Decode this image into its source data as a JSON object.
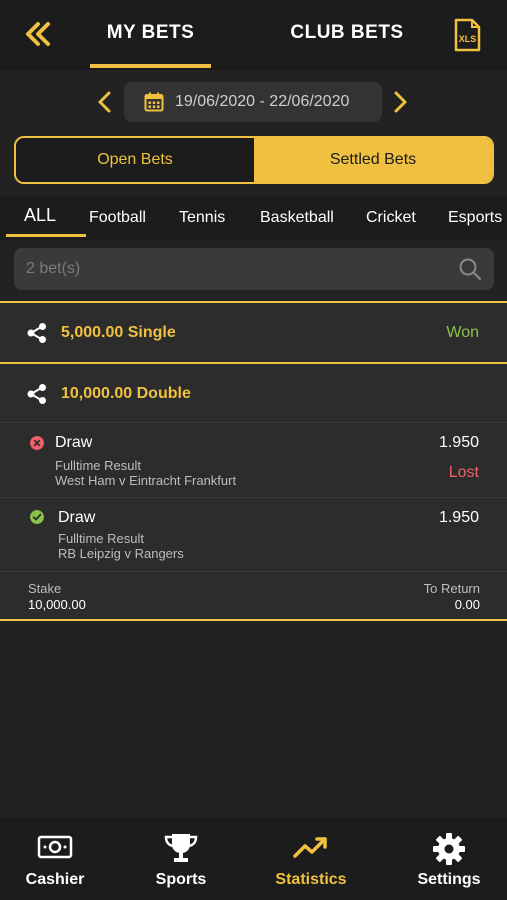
{
  "header": {
    "tabs": [
      {
        "label": "MY BETS",
        "active": true
      },
      {
        "label": "CLUB BETS",
        "active": false
      }
    ],
    "back_icon": "double-chevron-left-icon",
    "export_icon": "xls-file-icon"
  },
  "date_range": {
    "text": "19/06/2020 - 22/06/2020"
  },
  "toggle": {
    "open_label": "Open Bets",
    "settled_label": "Settled Bets",
    "selected": "Settled Bets"
  },
  "categories": [
    "ALL",
    "Football",
    "Tennis",
    "Basketball",
    "Cricket",
    "Esports"
  ],
  "search": {
    "placeholder": "2 bet(s)"
  },
  "bets": [
    {
      "title": "5,000.00 Single",
      "result": "Won"
    },
    {
      "title": "10,000.00 Double",
      "selections": [
        {
          "name": "Draw",
          "market": "Fulltime Result",
          "event": "West Ham v Eintracht Frankfurt",
          "odds": "1.950",
          "result": "Lost",
          "status": "lost"
        },
        {
          "name": "Draw",
          "market": "Fulltime Result",
          "event": "RB Leipzig v Rangers",
          "odds": "1.950",
          "status": "won"
        }
      ],
      "stake_label": "Stake",
      "stake": "10,000.00",
      "return_label": "To Return",
      "return": "0.00"
    }
  ],
  "bottom_nav": [
    {
      "label": "Cashier",
      "icon": "cash-icon"
    },
    {
      "label": "Sports",
      "icon": "trophy-icon"
    },
    {
      "label": "Statistics",
      "icon": "trend-up-icon",
      "active": true
    },
    {
      "label": "Settings",
      "icon": "gear-icon"
    }
  ],
  "colors": {
    "accent": "#f0c040",
    "won": "#8bc34a",
    "lost": "#f0606a",
    "background": "#222222"
  }
}
